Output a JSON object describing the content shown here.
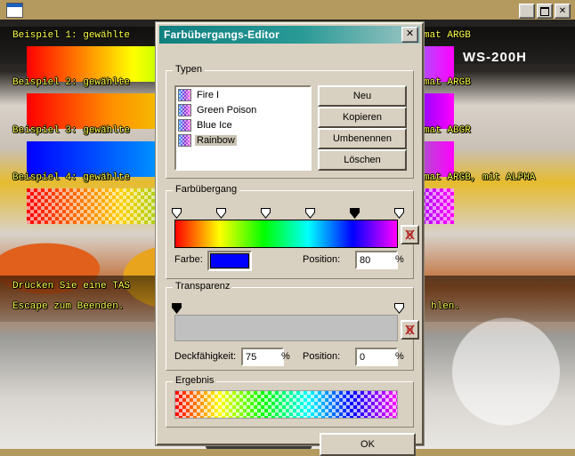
{
  "background_window": {
    "title": "",
    "window_buttons": {
      "minimize": "_",
      "maximize": "□",
      "close": "✕"
    },
    "lines": [
      "Beispiel 1: gewählte",
      "Beispiel 2: gewählte",
      "Beispiel 3: gewählte",
      "Beispiel 4: gewählte",
      "Drücken Sie eine TAS",
      "Escape zum Beenden."
    ],
    "right_lines": [
      "mat ARGB",
      "mat ARGB",
      "mat ABGR",
      "mat ARGB, mit ALPHA",
      "hlen."
    ],
    "device_label": "WS-200H"
  },
  "dialog": {
    "title": "Farbübergangs-Editor",
    "close_label": "✕",
    "groups": {
      "typen": {
        "label": "Typen",
        "items": [
          {
            "name": "Fire I",
            "selected": false
          },
          {
            "name": "Green Poison",
            "selected": false
          },
          {
            "name": "Blue Ice",
            "selected": false
          },
          {
            "name": "Rainbow",
            "selected": true
          }
        ],
        "buttons": [
          {
            "label": "Neu"
          },
          {
            "label": "Kopieren"
          },
          {
            "label": "Umbenennen"
          },
          {
            "label": "Löschen"
          }
        ]
      },
      "farbuebergang": {
        "label": "Farbübergang",
        "stops": [
          {
            "position": 0,
            "color": "#ff0000",
            "selected": false
          },
          {
            "position": 20,
            "color": "#ffff00",
            "selected": false
          },
          {
            "position": 40,
            "color": "#00ff00",
            "selected": false
          },
          {
            "position": 60,
            "color": "#00ffff",
            "selected": false
          },
          {
            "position": 80,
            "color": "#0000ff",
            "selected": true
          },
          {
            "position": 100,
            "color": "#ff00ff",
            "selected": false
          }
        ],
        "color_label": "Farbe:",
        "color_value": "#0000ff",
        "position_label": "Position:",
        "position_value": "80",
        "percent_sign": "%",
        "delete_stop_icon": "delete-stop-icon"
      },
      "transparenz": {
        "label": "Transparenz",
        "stops": [
          {
            "position": 0,
            "opacity": 75,
            "selected": true
          },
          {
            "position": 100,
            "opacity": 75,
            "selected": false
          }
        ],
        "bar_color": "#c0c0c0",
        "opacity_label": "Deckfähigkeit:",
        "opacity_value": "75",
        "position_label": "Position:",
        "position_value": "0",
        "percent_sign": "%",
        "delete_stop_icon": "delete-stop-icon"
      },
      "ergebnis": {
        "label": "Ergebnis"
      }
    },
    "ok_button": "OK"
  },
  "colors": {
    "dialog_face": "#d8d0c0",
    "titlebar_start": "#0f7f7f",
    "titlebar_end": "#9fc6c4",
    "desktop": "#b49a5e",
    "accent_blue": "#0000ff"
  }
}
